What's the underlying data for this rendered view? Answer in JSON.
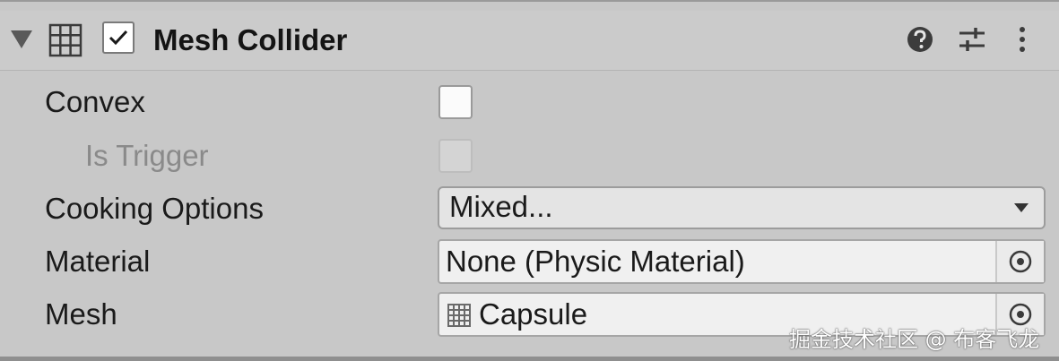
{
  "component": {
    "title": "Mesh Collider",
    "enabled": true,
    "icon": "mesh-grid-icon",
    "header_buttons": [
      "help-icon",
      "presets-icon",
      "more-options-icon"
    ]
  },
  "properties": {
    "convex": {
      "label": "Convex",
      "checked": false
    },
    "is_trigger": {
      "label": "Is Trigger",
      "checked": false,
      "disabled": true
    },
    "cooking_options": {
      "label": "Cooking Options",
      "value": "Mixed..."
    },
    "material": {
      "label": "Material",
      "value": "None (Physic Material)"
    },
    "mesh": {
      "label": "Mesh",
      "value": "Capsule",
      "icon": "mesh-grid-icon"
    }
  },
  "watermark": "掘金技术社区 @ 布客飞龙",
  "colors": {
    "panel_bg": "#c8c8c8",
    "field_bg": "#f0f0f0",
    "text": "#1a1a1a",
    "disabled_text": "#8a8a8a"
  }
}
